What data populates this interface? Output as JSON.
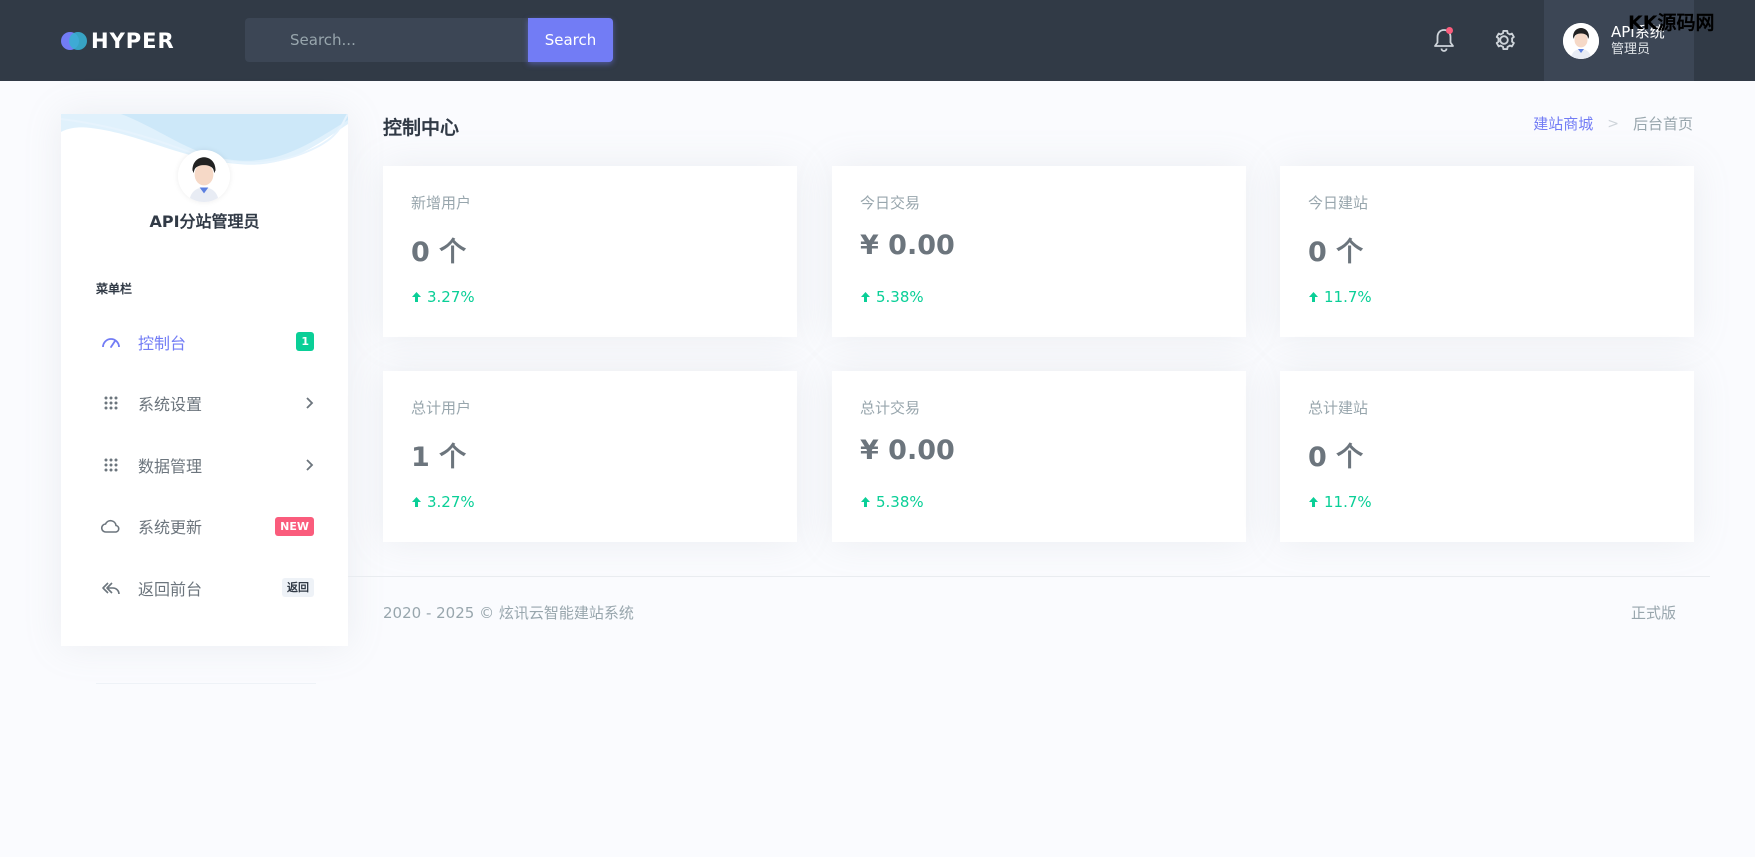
{
  "topbar": {
    "logo_text": "HYPER",
    "search": {
      "placeholder": "Search...",
      "button_label": "Search"
    },
    "user": {
      "name": "API系统",
      "role": "管理员"
    },
    "watermark": "KK源码网"
  },
  "sidebar": {
    "admin_name": "API分站管理员",
    "menu_title": "菜单栏",
    "items": [
      {
        "label": "控制台",
        "icon": "dashboard-icon",
        "badge": "1"
      },
      {
        "label": "系统设置",
        "icon": "grid-icon"
      },
      {
        "label": "数据管理",
        "icon": "grid-icon"
      },
      {
        "label": "系统更新",
        "icon": "cloud-icon",
        "badge": "NEW"
      },
      {
        "label": "返回前台",
        "icon": "reply-all-icon",
        "badge": "返回"
      }
    ]
  },
  "page": {
    "title": "控制中心",
    "breadcrumb": {
      "link": "建站商城",
      "separator": ">",
      "current": "后台首页"
    }
  },
  "cards": [
    {
      "label": "新增用户",
      "value": "0 个",
      "change": "3.27%"
    },
    {
      "label": "今日交易",
      "value": "¥ 0.00",
      "change": "5.38%"
    },
    {
      "label": "今日建站",
      "value": "0 个",
      "change": "11.7%"
    },
    {
      "label": "总计用户",
      "value": "1 个",
      "change": "3.27%"
    },
    {
      "label": "总计交易",
      "value": "¥ 0.00",
      "change": "5.38%"
    },
    {
      "label": "总计建站",
      "value": "0 个",
      "change": "11.7%"
    }
  ],
  "footer": {
    "copyright": "2020 - 2025 © 炫讯云智能建站系统",
    "edition": "正式版"
  },
  "colors": {
    "primary": "#727cf5",
    "success": "#0acf97",
    "danger": "#fa5c7c",
    "topbar": "#313a46"
  }
}
